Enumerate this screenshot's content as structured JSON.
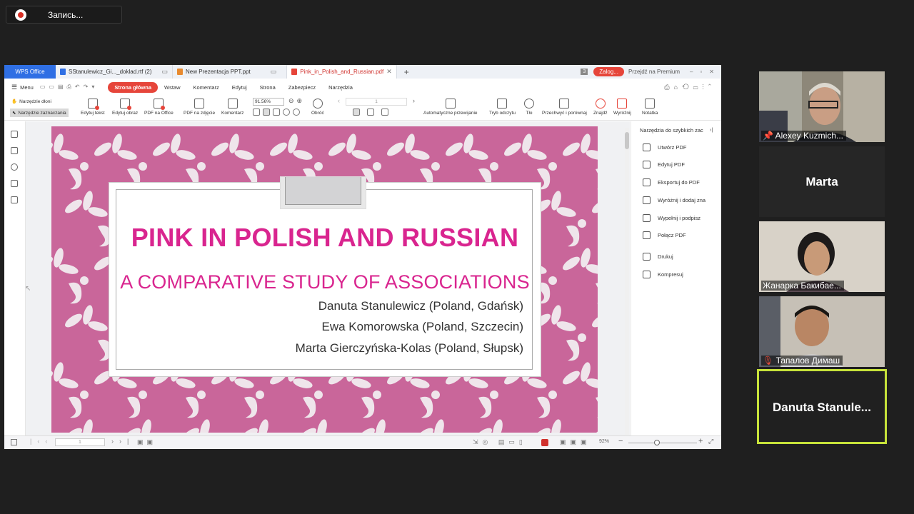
{
  "recording": {
    "label": "Запись..."
  },
  "wps": {
    "brand": "WPS Office",
    "tabs": [
      {
        "label": "SStanulewicz_Gi..._doklad.rtf (2)"
      },
      {
        "label": "New Prezentacja PPT.ppt"
      },
      {
        "label": "Pink_in_Polish_and_Russian.pdf"
      }
    ],
    "new_tab": "+",
    "tab_count": "3",
    "login": "Zalog...",
    "premium": "Przejdź na Premium",
    "menu": {
      "menu_label": "Menu",
      "items": [
        "Strona główna",
        "Wstaw",
        "Komentarz",
        "Edytuj",
        "Strona",
        "Zabezpiecz",
        "Narzędzia"
      ]
    },
    "toolbar": {
      "hand_tool": "Narzędzie dłoni",
      "select_tool": "Narzędzie zaznaczania",
      "edit_text": "Edytuj tekst",
      "edit_image": "Edytuj obraz",
      "pdf_to_office": "PDF na Office",
      "pdf_to_image": "PDF na zdjęcie",
      "comment": "Komentarz",
      "zoom": "91.56%",
      "rotate": "Obróć",
      "page_box": "1",
      "auto_scroll": "Automatyczne przewijanie",
      "read_mode": "Tryb odczytu",
      "background": "Tło",
      "compare": "Przechwyć i porównaj",
      "find": "Znajdź",
      "highlight": "Wyróżnij",
      "note": "Notatka"
    },
    "slide": {
      "title": "PINK IN POLISH AND RUSSIAN",
      "subtitle": "A COMPARATIVE STUDY OF ASSOCIATIONS",
      "authors": [
        "Danuta Stanulewicz (Poland, Gdańsk)",
        "Ewa Komorowska (Poland, Szczecin)",
        "Marta Gierczyńska-Kolas (Poland, Słupsk)"
      ]
    },
    "right_panel": {
      "title": "Narzędzia do szybkich zac",
      "items": [
        "Utwórz PDF",
        "Edytuj PDF",
        "Eksportuj do PDF",
        "Wyróżnij i dodaj zna",
        "Wypełnij i podpisz",
        "Połącz PDF",
        "Drukuj",
        "Kompresuj"
      ]
    },
    "status": {
      "page": "1",
      "zoom": "92%"
    }
  },
  "participants": [
    {
      "name": "Alexey Kuzmich..."
    },
    {
      "name": "Marta"
    },
    {
      "name": "Жанарка Бакибае..."
    },
    {
      "name": "Тапалов Димаш"
    },
    {
      "name": "Danuta  Stanule..."
    }
  ],
  "colors": {
    "slide_bg": "#c9669a",
    "title": "#d9258f",
    "wps_blue": "#2f6fe4",
    "accent": "#e6453a",
    "active_speaker": "#c7e23a"
  }
}
